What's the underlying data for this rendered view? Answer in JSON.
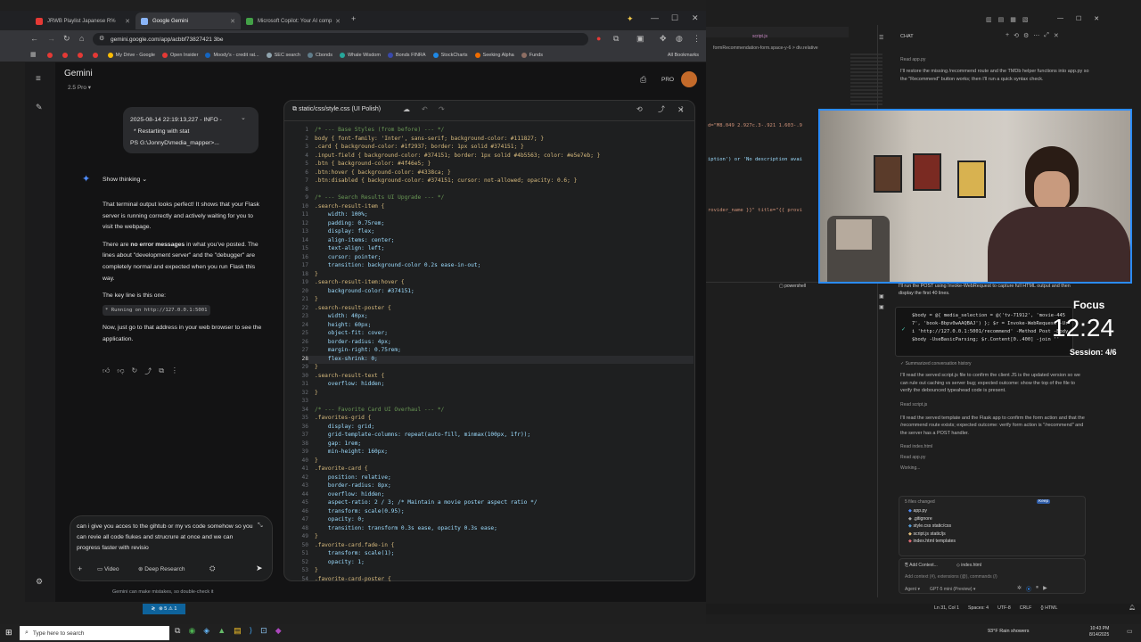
{
  "browser": {
    "tabs": [
      {
        "label": "JRWB Playlist Japanese R%",
        "color": "#e53935"
      },
      {
        "label": "Google Gemini",
        "color": "#8ab4f8"
      },
      {
        "label": "Microsoft Copilot: Your AI comp",
        "color": "#43a047"
      }
    ],
    "url": "gemini.google.com/app/acbbf73827421 3be",
    "bookmarks": [
      {
        "label": "",
        "color": "#e53935"
      },
      {
        "label": "",
        "color": "#e53935"
      },
      {
        "label": "",
        "color": "#e53935"
      },
      {
        "label": "",
        "color": "#e53935"
      },
      {
        "label": "My Drive - Google",
        "color": "#fbbc04"
      },
      {
        "label": "Open Insider",
        "color": "#e53935"
      },
      {
        "label": "Moody's - credit rat...",
        "color": "#1565c0"
      },
      {
        "label": "SEC search",
        "color": "#90a4ae"
      },
      {
        "label": "Cbonds",
        "color": "#607d8b"
      },
      {
        "label": "Whale Wisdom",
        "color": "#26a69a"
      },
      {
        "label": "Bonds FINRA",
        "color": "#3949ab"
      },
      {
        "label": "StockCharts",
        "color": "#1e88e5"
      },
      {
        "label": "Seeking Alpha",
        "color": "#ef6c00"
      },
      {
        "label": "Funds",
        "color": "#8d6e63"
      }
    ],
    "all_bookmarks": "All Bookmarks"
  },
  "gemini": {
    "brand": "Gemini",
    "model": "2.5 Pro",
    "pro_badge": "PRO",
    "user_bubble": [
      "2025-08-14 22:19:13,227 - INFO -",
      "* Restarting with stat",
      "PS G:\\JonnyD\\media_mapper>..."
    ],
    "show_thinking": "Show thinking",
    "resp_p1": "That terminal output looks perfect! It shows that your Flask server is running correctly and actively waiting for you to visit the webpage.",
    "resp_p2_pre": "There are ",
    "resp_p2_bold": "no error messages",
    "resp_p2_post": " in what you've posted. The lines about \"development server\" and the \"debugger\" are completely normal and expected when you run Flask this way.",
    "resp_p3": "The key line is this one:",
    "resp_code": "* Running on http://127.0.0.1:5001",
    "resp_p4": "Now, just go to that address in your web browser to see the application.",
    "composer_text": "can i give you acces to the gihtub or my vs code somehow so you can revie all code fiukes and strucrure at once and we can progress faster with revisio",
    "video": "Video",
    "deep_research": "Deep Research",
    "disclaimer": "Gemini can make mistakes, so double-check it"
  },
  "editor": {
    "title": "static/css/style.css (UI Polish)",
    "lines": [
      "/* --- Base Styles (from before) --- */",
      "body { font-family: 'Inter', sans-serif; background-color: #111827; }",
      ".card { background-color: #1f2937; border: 1px solid #374151; }",
      ".input-field { background-color: #374151; border: 1px solid #4b5563; color: #e5e7eb; }",
      ".btn { background-color: #4f46e5; }",
      ".btn:hover { background-color: #4338ca; }",
      ".btn:disabled { background-color: #374151; cursor: not-allowed; opacity: 0.6; }",
      "",
      "/* --- Search Results UI Upgrade --- */",
      ".search-result-item {",
      "    width: 100%;",
      "    padding: 0.75rem;",
      "    display: flex;",
      "    align-items: center;",
      "    text-align: left;",
      "    cursor: pointer;",
      "    transition: background-color 0.2s ease-in-out;",
      "}",
      ".search-result-item:hover {",
      "    background-color: #374151;",
      "}",
      ".search-result-poster {",
      "    width: 40px;",
      "    height: 60px;",
      "    object-fit: cover;",
      "    border-radius: 4px;",
      "    margin-right: 0.75rem;",
      "    flex-shrink: 0;",
      "}",
      ".search-result-text {",
      "    overflow: hidden;",
      "}",
      "",
      "/* --- Favorite Card UI Overhaul --- */",
      ".favorites-grid {",
      "    display: grid;",
      "    grid-template-columns: repeat(auto-fill, minmax(100px, 1fr));",
      "    gap: 1rem;",
      "    min-height: 160px;",
      "}",
      ".favorite-card {",
      "    position: relative;",
      "    border-radius: 8px;",
      "    overflow: hidden;",
      "    aspect-ratio: 2 / 3; /* Maintain a movie poster aspect ratio */",
      "    transform: scale(0.95);",
      "    opacity: 0;",
      "    transition: transform 0.3s ease, opacity 0.3s ease;",
      "}",
      ".favorite-card.fade-in {",
      "    transform: scale(1);",
      "    opacity: 1;",
      "}",
      ".favorite-card-poster {"
    ]
  },
  "vscode": {
    "breadcrumb": "formRecommendation-form.space-y-6 > div.relative",
    "code_frag1": "d=\"M8.049 2.927c.3-.921 1.603-.9",
    "code_frag2": "iption') or 'No description avai",
    "code_frag3": "rovider_name }}\" title=\"{{ provi",
    "chat_label": "CHAT",
    "read_app": "Read  app.py",
    "chat_p1": "I'll restore the missing /recommend route and the TMDb helper functions into app.py so the \"Recommend\" button works; then I'll run a quick syntax check.",
    "chat_p2": "I'll run the POST using Invoke-WebRequest to capture full HTML output and then display the first 40 lines.",
    "ps_cmd": "$body = @{ media_selection = @('tv-71912', 'movie-4457', 'book-8bpv0wAAQBAJ') }; $r = Invoke-WebRequest -Uri 'http://127.0.0.1:5001/recommend' -Method Post -Body $body -UseBasicParsing; $r.Content[0..400] -join ''",
    "summarized": "Summarized conversation history",
    "chat_p3": "I'll read the served script.js file to confirm the client JS is the updated version so we can rule out caching vs server bug; expected outcome: show the top of the file to verify the debounced typeahead code is present.",
    "read_script": "Read  script.js",
    "chat_p4": "I'll read the served template and the Flask app to confirm the form action and that the /recommend route exists; expected outcome: verify form action is \"/recommend\" and the server has a POST handler.",
    "read_index": "Read  index.html",
    "read_app2": "Read  app.py",
    "working": "Working...",
    "files_changed": "5 files changed",
    "files": [
      "app.py",
      ".gitignore",
      "style.css  static/css",
      "script.js  static/js",
      "index.html  templates"
    ],
    "add_context": "Add Context...",
    "context_file": "index.html",
    "context_hint": "Add context (#), extensions (@), commands (/)",
    "agent": "Agent",
    "model": "GPT-5 mini (Preview)",
    "status": [
      "Ln 31, Col 1",
      "Spaces: 4",
      "UTF-8",
      "CRLF",
      "{} HTML"
    ],
    "powershell": "powershell",
    "focus_title": "Focus",
    "focus_time": "12:24",
    "session": "Session: 4/6"
  },
  "taskbar": {
    "search_placeholder": "Type here to search",
    "weather": "93°F  Rain showers",
    "time": "10:43 PM",
    "date": "8/14/2025",
    "remote_status": "⊗ 5 ⚠ 1"
  }
}
